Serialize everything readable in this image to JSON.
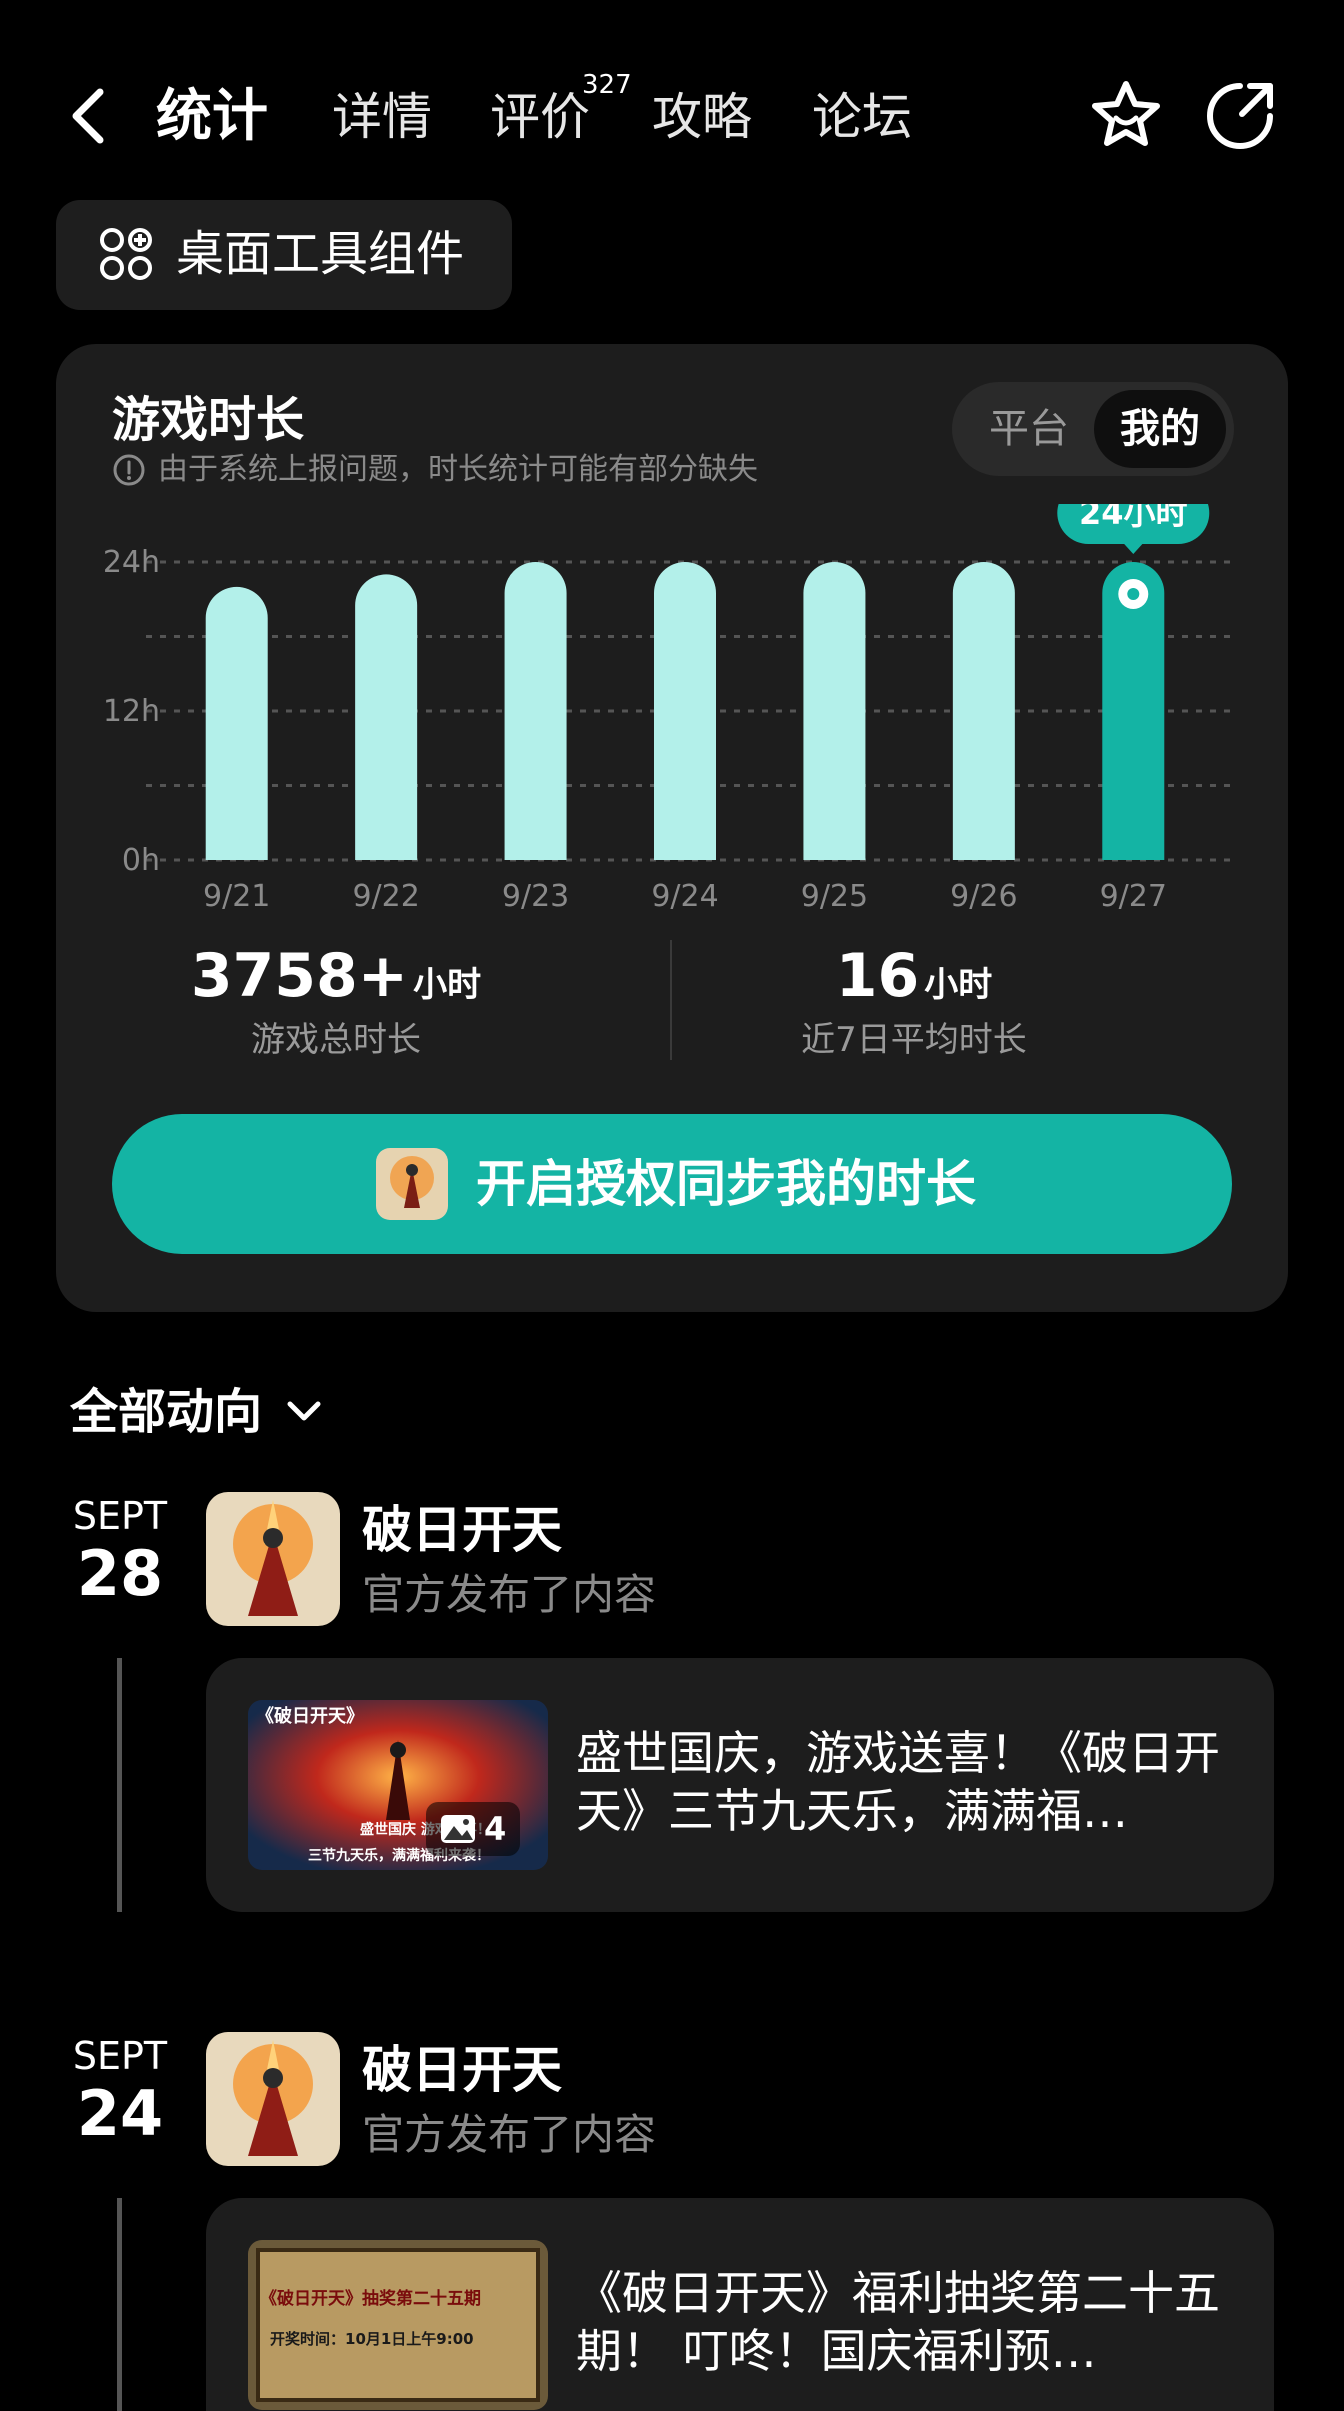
{
  "nav": {
    "tabs": [
      {
        "label": "统计",
        "active": true
      },
      {
        "label": "详情"
      },
      {
        "label": "评价",
        "badge": "327"
      },
      {
        "label": "攻略"
      },
      {
        "label": "论坛"
      }
    ]
  },
  "widget_chip": {
    "label": "桌面工具组件",
    "icon": "widgets-add-icon"
  },
  "playtime_card": {
    "title": "游戏时长",
    "note": "由于系统上报问题，时长统计可能有部分缺失",
    "toggle": {
      "options": [
        "平台",
        "我的"
      ],
      "selected": "我的"
    },
    "stats": {
      "total_value": "3758+",
      "total_unit": "小时",
      "total_caption": "游戏总时长",
      "avg_value": "16",
      "avg_unit": "小时",
      "avg_caption": "近7日平均时长"
    },
    "sync_button": "开启授权同步我的时长"
  },
  "chart_data": {
    "type": "bar",
    "categories": [
      "9/21",
      "9/22",
      "9/23",
      "9/24",
      "9/25",
      "9/26",
      "9/27"
    ],
    "values": [
      22,
      23,
      24,
      24,
      24,
      24,
      24
    ],
    "y_ticks": [
      "0h",
      "12h",
      "24h"
    ],
    "ylim": [
      0,
      24
    ],
    "highlight_index": 6,
    "highlight_label": "24小时",
    "colors": {
      "bar": "#b3f0ea",
      "highlight": "#14b4a4",
      "grid": "#555555"
    }
  },
  "feed": {
    "filter_label": "全部动向",
    "entries": [
      {
        "month": "SEPT",
        "day": "28",
        "app_name": "破日开天",
        "subtitle": "官方发布了内容",
        "post_title": "盛世国庆，游戏送喜！《破日开天》三节九天乐，满满福…",
        "thumb_title": "《破日开天》",
        "thumb_line1": "盛世国庆 游戏送喜！",
        "thumb_line2": "三节九天乐，满满福利来袭！",
        "image_count": "4"
      },
      {
        "month": "SEPT",
        "day": "24",
        "app_name": "破日开天",
        "subtitle": "官方发布了内容",
        "post_title": "《破日开天》福利抽奖第二十五期！ 叮咚！国庆福利预…",
        "thumb_title": "《破日开天》抽奖第二十五期",
        "thumb_line1": "开奖时间：10月1日上午9:00"
      }
    ]
  }
}
